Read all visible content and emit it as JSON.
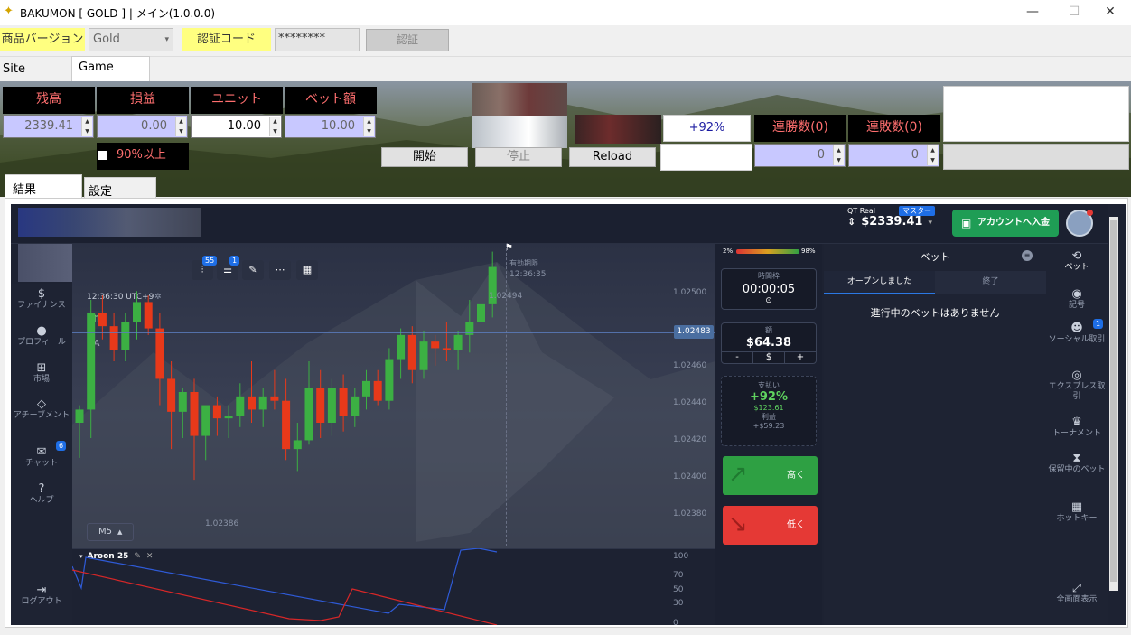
{
  "window": {
    "title": "BAKUMON [  GOLD  ] | メイン(1.0.0.0)",
    "min": "—",
    "max": "☐",
    "close": "✕"
  },
  "toolbar": {
    "product_label": "商品バージョン",
    "product_value": "Gold",
    "auth_label": "認証コード",
    "auth_value": "********",
    "auth_button": "認証"
  },
  "tabs": {
    "site": "Site",
    "game": "Game"
  },
  "stats": {
    "balance_label": "残高",
    "balance_value": "2339.41",
    "pnl_label": "損益",
    "pnl_value": "0.00",
    "unit_label": "ユニット",
    "unit_value": "10.00",
    "bet_label": "ベット額",
    "bet_value": "10.00",
    "filter_label": "90%以上"
  },
  "controls": {
    "payout": "+92%",
    "start": "開始",
    "stop": "停止",
    "reload": "Reload",
    "win_streak_label": "連勝数(0)",
    "lose_streak_label": "連敗数(0)",
    "win_streak_value": "0",
    "lose_streak_value": "0"
  },
  "subtabs": {
    "result": "結果",
    "settings": "設定"
  },
  "platform": {
    "account_type": "QT Real",
    "master_badge": "マスター",
    "balance": "$2339.41",
    "deposit_button": "アカウントへ入金",
    "toolbar_badges": [
      "55",
      "1"
    ],
    "chart_time": "12:36:30 UTC+9",
    "expiry_label": "有効期限",
    "expiry_time": "12:36:35",
    "timeframe": "M5",
    "indicator": "Aroon 25",
    "sentiment_low": "2%",
    "sentiment_high": "98%",
    "time_label": "時間枠",
    "time_value": "00:00:05",
    "amount_label": "額",
    "amount_value": "$64.38",
    "amount_minus": "-",
    "amount_currency": "$",
    "amount_plus": "+",
    "payout_label": "支払い",
    "payout_pct": "+92%",
    "payout_value": "$123.61",
    "profit_label": "利益",
    "profit_value": "+$59.23",
    "high_label": "高く",
    "low_label": "低く",
    "bets_title": "ベット",
    "tab_open": "オープンしました",
    "tab_closed": "終了",
    "no_bets": "進行中のベットはありません",
    "left_nav": [
      {
        "icon": "$",
        "label": "ファイナンス"
      },
      {
        "icon": "●",
        "label": "プロフィール"
      },
      {
        "icon": "⊞",
        "label": "市場"
      },
      {
        "icon": "◇",
        "label": "アチーブメント"
      },
      {
        "icon": "✉",
        "label": "チャット"
      },
      {
        "icon": "?",
        "label": "ヘルプ"
      },
      {
        "icon": "⇥",
        "label": "ログアウト"
      }
    ],
    "chat_badge": "6",
    "right_nav": [
      {
        "icon": "⟲",
        "label": "ベット"
      },
      {
        "icon": "◉",
        "label": "記号"
      },
      {
        "icon": "☻",
        "label": "ソーシャル取引"
      },
      {
        "icon": "◎",
        "label": "エクスプレス取引"
      },
      {
        "icon": "♛",
        "label": "トーナメント"
      },
      {
        "icon": "⧗",
        "label": "保留中のベット"
      },
      {
        "icon": "▦",
        "label": "ホットキー"
      },
      {
        "icon": "⤢",
        "label": "全画面表示"
      }
    ],
    "social_badge": "1",
    "price_levels": [
      "1.02500",
      "1.02480",
      "1.02460",
      "1.02440",
      "1.02420",
      "1.02400",
      "1.02380"
    ],
    "current_price": "1.02483",
    "high_price": "1.02494",
    "low_price": "1.02386",
    "aroon_levels": [
      "100",
      "70",
      "50",
      "30",
      "0"
    ]
  },
  "chart_data": {
    "type": "candlestick",
    "candles": [
      [
        1.02412,
        1.0242,
        1.02396,
        1.02418
      ],
      [
        1.02418,
        1.02468,
        1.02405,
        1.02462
      ],
      [
        1.02462,
        1.0247,
        1.0245,
        1.02456
      ],
      [
        1.02456,
        1.02462,
        1.0244,
        1.02445
      ],
      [
        1.02445,
        1.02462,
        1.0244,
        1.02458
      ],
      [
        1.02458,
        1.02472,
        1.0245,
        1.02467
      ],
      [
        1.02467,
        1.0247,
        1.02452,
        1.02455
      ],
      [
        1.02455,
        1.02462,
        1.0242,
        1.02432
      ],
      [
        1.02432,
        1.0244,
        1.024,
        1.02417
      ],
      [
        1.02417,
        1.02428,
        1.02405,
        1.02426
      ],
      [
        1.02426,
        1.02432,
        1.02386,
        1.02406
      ],
      [
        1.02406,
        1.02418,
        1.02395,
        1.0242
      ],
      [
        1.0242,
        1.02424,
        1.02406,
        1.02414
      ],
      [
        1.02414,
        1.0242,
        1.02405,
        1.02415
      ],
      [
        1.02415,
        1.0243,
        1.0241,
        1.02424
      ],
      [
        1.02424,
        1.0244,
        1.02412,
        1.02418
      ],
      [
        1.02418,
        1.02428,
        1.0241,
        1.02424
      ],
      [
        1.02424,
        1.02436,
        1.02418,
        1.02422
      ],
      [
        1.02422,
        1.02432,
        1.02395,
        1.024
      ],
      [
        1.024,
        1.02412,
        1.0239,
        1.02404
      ],
      [
        1.02404,
        1.0244,
        1.02402,
        1.02428
      ],
      [
        1.02428,
        1.02436,
        1.02405,
        1.02412
      ],
      [
        1.02412,
        1.02432,
        1.02406,
        1.02428
      ],
      [
        1.02428,
        1.02434,
        1.02408,
        1.02415
      ],
      [
        1.02415,
        1.02428,
        1.0241,
        1.02424
      ],
      [
        1.02424,
        1.02436,
        1.02418,
        1.02431
      ],
      [
        1.02431,
        1.02436,
        1.0242,
        1.02422
      ],
      [
        1.02422,
        1.02446,
        1.02418,
        1.02441
      ],
      [
        1.02441,
        1.02455,
        1.02432,
        1.02452
      ],
      [
        1.02452,
        1.02456,
        1.0243,
        1.02436
      ],
      [
        1.02436,
        1.02454,
        1.02432,
        1.02449
      ],
      [
        1.02449,
        1.02452,
        1.02438,
        1.02446
      ],
      [
        1.02446,
        1.02458,
        1.0244,
        1.02445
      ],
      [
        1.02445,
        1.02454,
        1.02436,
        1.02452
      ],
      [
        1.02452,
        1.02468,
        1.02444,
        1.02458
      ],
      [
        1.02458,
        1.02476,
        1.02452,
        1.02466
      ],
      [
        1.02466,
        1.0249,
        1.0246,
        1.02483
      ]
    ],
    "ylim": [
      1.0237,
      1.0251
    ]
  }
}
